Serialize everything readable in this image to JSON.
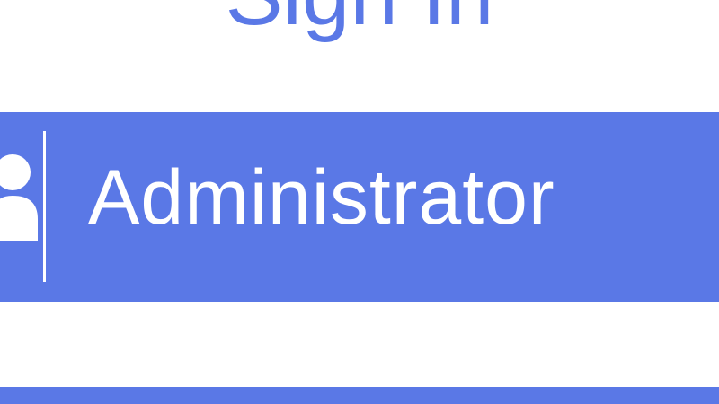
{
  "form": {
    "title": "Sign In",
    "username_value": "Administrator",
    "icon": "user-icon",
    "accent_color": "#5a78e6"
  }
}
